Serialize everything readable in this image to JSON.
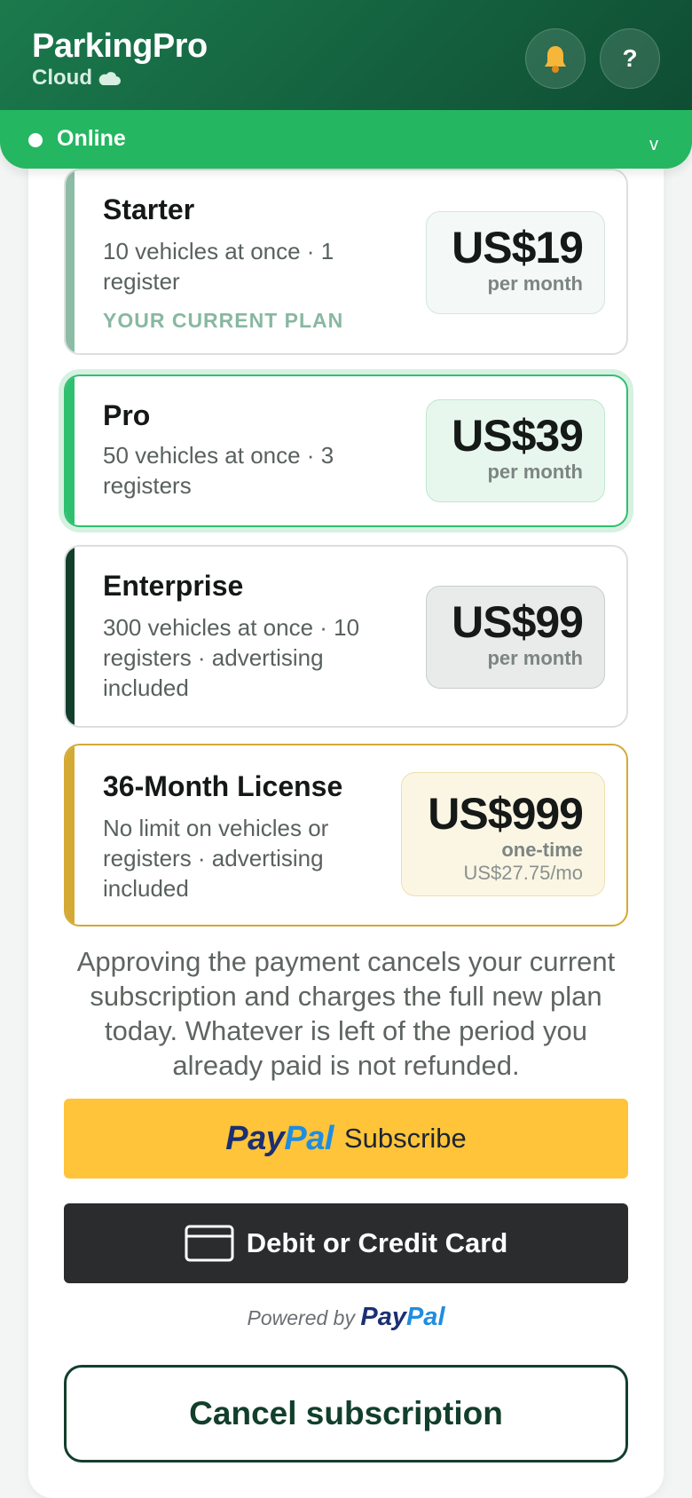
{
  "header": {
    "title": "ParkingPro",
    "subtitle": "Cloud",
    "icons": {
      "cloud": "cloud-icon",
      "notifications": "bell-icon",
      "help": "question-mark-icon"
    },
    "help_label": "?"
  },
  "status": {
    "label": "Online",
    "chevron": "v"
  },
  "plans": [
    {
      "name": "Starter",
      "description": "10 vehicles at once · 1 register",
      "tag": "YOUR CURRENT PLAN",
      "price": "US$19",
      "period": "per month",
      "accent_color": "#8dbca6"
    },
    {
      "name": "Pro",
      "description": "50 vehicles at once · 3 registers",
      "price": "US$39",
      "period": "per month",
      "accent_color": "#2fbf70"
    },
    {
      "name": "Enterprise",
      "description": "300 vehicles at once · 10 registers · advertising included",
      "price": "US$99",
      "period": "per month",
      "accent_color": "#123f2c"
    },
    {
      "name": "36-Month License",
      "description": "No limit on vehicles or registers · advertising included",
      "price": "US$999",
      "period": "one-time",
      "extra": "US$27.75/mo",
      "accent_color": "#d4a934"
    }
  ],
  "notice": "Approving the payment cancels your current subscription and charges the full new plan today. Whatever is left of the period you already paid is not refunded.",
  "payment": {
    "paypal_logo_part1": "Pay",
    "paypal_logo_part2": "Pal",
    "paypal_action": "Subscribe",
    "card_label": "Debit or Credit Card",
    "powered_by": "Powered by",
    "brand_colors": {
      "paypal_yellow": "#ffc439",
      "paypal_navy": "#1b2f72",
      "paypal_blue": "#1f8de0"
    }
  },
  "cancel_label": "Cancel subscription"
}
